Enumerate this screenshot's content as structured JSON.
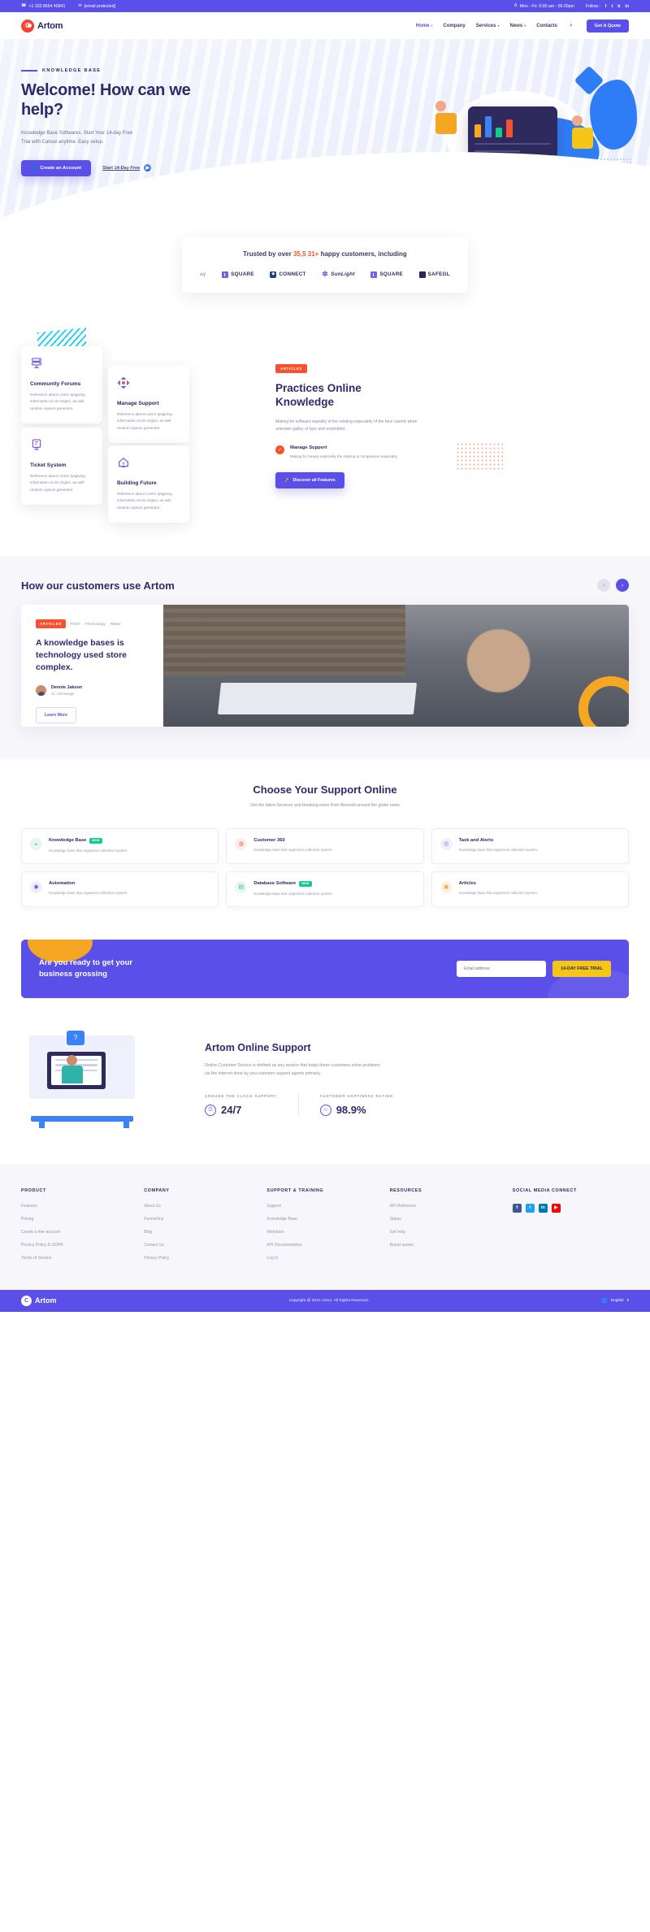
{
  "topbar": {
    "phone": "+1 333 8654 45841",
    "email": "[email protected]",
    "hours": "Mon - Fri: 9:00 am - 06.00pm",
    "follow_label": "Follow :",
    "socials": [
      "f",
      "t",
      "b",
      "in"
    ]
  },
  "header": {
    "brand": "Artom",
    "nav": [
      {
        "label": "Home",
        "caret": "▾",
        "active": true
      },
      {
        "label": "Company",
        "caret": "",
        "active": false
      },
      {
        "label": "Services",
        "caret": "▾",
        "active": false
      },
      {
        "label": "News",
        "caret": "▾",
        "active": false
      },
      {
        "label": "Contacts",
        "caret": "",
        "active": false
      }
    ],
    "search_icon": "⌕",
    "quote_button": "Get A Quote"
  },
  "hero": {
    "eyebrow": "KNOWLEDGE BASE",
    "title": "Welcome! How can we help?",
    "description": "Knowledge Base Softwares. Start Your 14-day Free Trial with Cancel anytime. Easy setup.",
    "primary_button": "Create an Account",
    "secondary_link": "Start 14-Day Free"
  },
  "trusted": {
    "text_before": "Trusted by over ",
    "highlight": "35,5 31+",
    "text_after": " happy customers, including",
    "logos": [
      {
        "name": "ay",
        "icon": "faded"
      },
      {
        "name": "SQUARE",
        "icon": "square"
      },
      {
        "name": "CONNECT",
        "icon": "connect"
      },
      {
        "name": "SunLight",
        "icon": "sun"
      },
      {
        "name": "SQUARE",
        "icon": "square"
      },
      {
        "name": "SAFEGL",
        "icon": "safe"
      }
    ]
  },
  "features": {
    "cards": [
      {
        "title": "Community Forums",
        "text": "Reference about Lorem Ipsgiving information on its origins, as well random Lipsum generator.",
        "icon": "server-icon"
      },
      {
        "title": "Manage Support",
        "text": "Reference about Lorem Ipsgiving information on its origins, as well random Lipsum generator.",
        "icon": "target-icon"
      },
      {
        "title": "Ticket System",
        "text": "Reference about Lorem Ipsgiving information on its origins, as well random Lipsum generator.",
        "icon": "ticket-icon"
      },
      {
        "title": "Building Future",
        "text": "Reference about Lorem Ipsgiving information on its origins, as well random Lipsum generator.",
        "icon": "house-icon"
      }
    ],
    "panel": {
      "tag": "ARTICLES",
      "title": "Practices Online Knowledge",
      "text": "Making for software espiality of the relating especiality of the face casmic when unknown galley of type and scrambled.",
      "check_title": "Manage Support",
      "check_text": "Making for beauty especially the relating to compassion especialty.",
      "button": "Discover all Features"
    }
  },
  "customers": {
    "title": "How our customers use Artom",
    "prev": "‹",
    "next": "›",
    "testimonial": {
      "tag": "ARTICLES",
      "tags": [
        "#Html",
        "#Technology",
        "#Base"
      ],
      "quote": "A knowledge bases is technology used store complex.",
      "author_name": "Dennie Jakson",
      "author_role": "UI \\ UX Design",
      "button": "Learn More"
    }
  },
  "support": {
    "title": "Choose Your Support Online",
    "subtitle": "Get the latest Services and breaking news from Wonrald around the globe news",
    "cards": [
      {
        "title": "Knowledge Base",
        "badge": "NEW",
        "text": "Knowledge base that organized collection system.",
        "icon": "book-icon",
        "color": "#e8f5f0",
        "glyph": "◒"
      },
      {
        "title": "Customer 360",
        "badge": "",
        "text": "Knowledge base that organized collection system.",
        "icon": "users-icon",
        "color": "#fdeeec",
        "glyph": "◍"
      },
      {
        "title": "Task and Alerts",
        "badge": "",
        "text": "Knowledge base that organized collection system.",
        "icon": "bell-icon",
        "color": "#eef0fd",
        "glyph": "◎"
      },
      {
        "title": "Automation",
        "badge": "",
        "text": "Knowledge base that organized collection system.",
        "icon": "gear-icon",
        "color": "#f2eefd",
        "glyph": "◉"
      },
      {
        "title": "Database Software",
        "badge": "NEW",
        "text": "Knowledge base that organized collection system.",
        "icon": "database-icon",
        "color": "#e9f7f1",
        "glyph": "▤"
      },
      {
        "title": "Articles",
        "badge": "",
        "text": "Knowledge base that organized collection system.",
        "icon": "article-icon",
        "color": "#fdf2e8",
        "glyph": "▣"
      }
    ]
  },
  "cta": {
    "title": "Are you ready to get your business grossing",
    "placeholder": "Email address",
    "button": "14-DAY FREE TRIAL"
  },
  "online": {
    "title": "Artom Online Support",
    "text": "Online Customer Service is defined as any service that helps these customers solve problems via the internet done by you customer support agents primarly.",
    "stats": [
      {
        "label": "AROUND THE CLOCK SUPPORT",
        "value": "24/7",
        "icon": "clock-icon"
      },
      {
        "label": "CUSTOMER HAPPINESS RATING",
        "value": "98.9%",
        "icon": "smile-icon"
      }
    ]
  },
  "footer": {
    "columns": [
      {
        "heading": "PRODUCT",
        "links": [
          "Features",
          "Pricing",
          "Create a free account",
          "Privacy Policy & GDPR",
          "Terms of Service"
        ]
      },
      {
        "heading": "COMPANY",
        "links": [
          "About Us",
          "FunnelUny",
          "Blog",
          "Contact Us",
          "Privacy Policy"
        ]
      },
      {
        "heading": "SUPPORT & TRAINING",
        "links": [
          "Support",
          "Knowledge Base",
          "Webinars",
          "API Documentation",
          "Log In"
        ]
      },
      {
        "heading": "RESOURCES",
        "links": [
          "API Reference",
          "Status",
          "Get help",
          "Brand assets"
        ]
      },
      {
        "heading": "SOCIAL MEDIA CONNECT",
        "links": []
      }
    ],
    "socials": [
      {
        "glyph": "f",
        "cls": "fb"
      },
      {
        "glyph": "t",
        "cls": "tw"
      },
      {
        "glyph": "in",
        "cls": "li"
      },
      {
        "glyph": "▶",
        "cls": "yt"
      }
    ],
    "bottom": {
      "brand": "Artom",
      "copyright": "Copyright @ 2021 Artom. All Rights Reserved.",
      "language": "English",
      "lang_caret": "▾"
    }
  }
}
